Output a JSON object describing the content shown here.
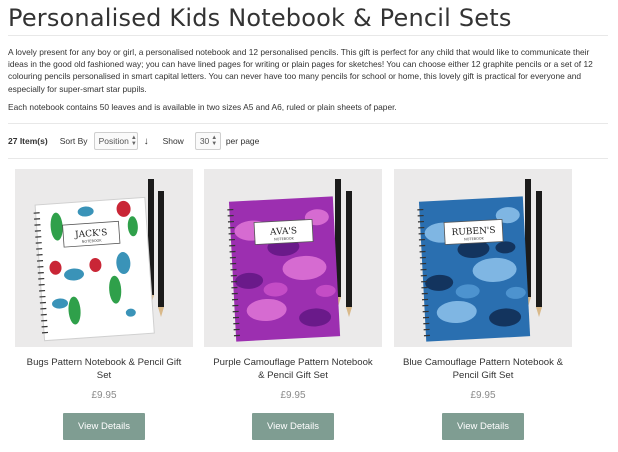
{
  "page": {
    "title": "Personalised Kids Notebook & Pencil Sets",
    "intro_1": "A lovely present for any boy or girl, a personalised notebook and 12 personalised pencils. This gift is perfect for any child that would like to communicate their ideas in the good old fashioned way; you can have lined pages for writing or plain pages for sketches! You can choose either 12 graphite pencils or a set of 12 colouring pencils personalised in smart capital letters. You can never have too many pencils for school or home, this lovely gift is practical for everyone and especially for super-smart star pupils.",
    "intro_2": "Each notebook contains 50 leaves and is available in two sizes A5 and A6, ruled or plain sheets of paper."
  },
  "toolbar": {
    "item_count": "27 Item(s)",
    "sort_label": "Sort By",
    "sort_value": "Position",
    "sort_arrow": "↓",
    "show_label": "Show",
    "per_page_value": "30",
    "per_page_suffix": "per page"
  },
  "products": [
    {
      "name": "Bugs Pattern Notebook & Pencil Gift Set",
      "price": "£9.95",
      "button": "View Details",
      "cover_name": "JACK'S",
      "cover_sub": "NOTEBOOK",
      "icon": "bugs-notebook-image"
    },
    {
      "name": "Purple Camouflage Pattern Notebook & Pencil Gift Set",
      "price": "£9.95",
      "button": "View Details",
      "cover_name": "AVA'S",
      "cover_sub": "NOTEBOOK",
      "icon": "purple-camo-notebook-image"
    },
    {
      "name": "Blue Camouflage Pattern Notebook & Pencil Gift Set",
      "price": "£9.95",
      "button": "View Details",
      "cover_name": "RUBEN'S",
      "cover_sub": "NOTEBOOK",
      "icon": "blue-camo-notebook-image"
    }
  ],
  "colors": {
    "button_bg": "#7f9d92",
    "price": "#8a8a8a",
    "image_bg": "#ebeaea"
  }
}
